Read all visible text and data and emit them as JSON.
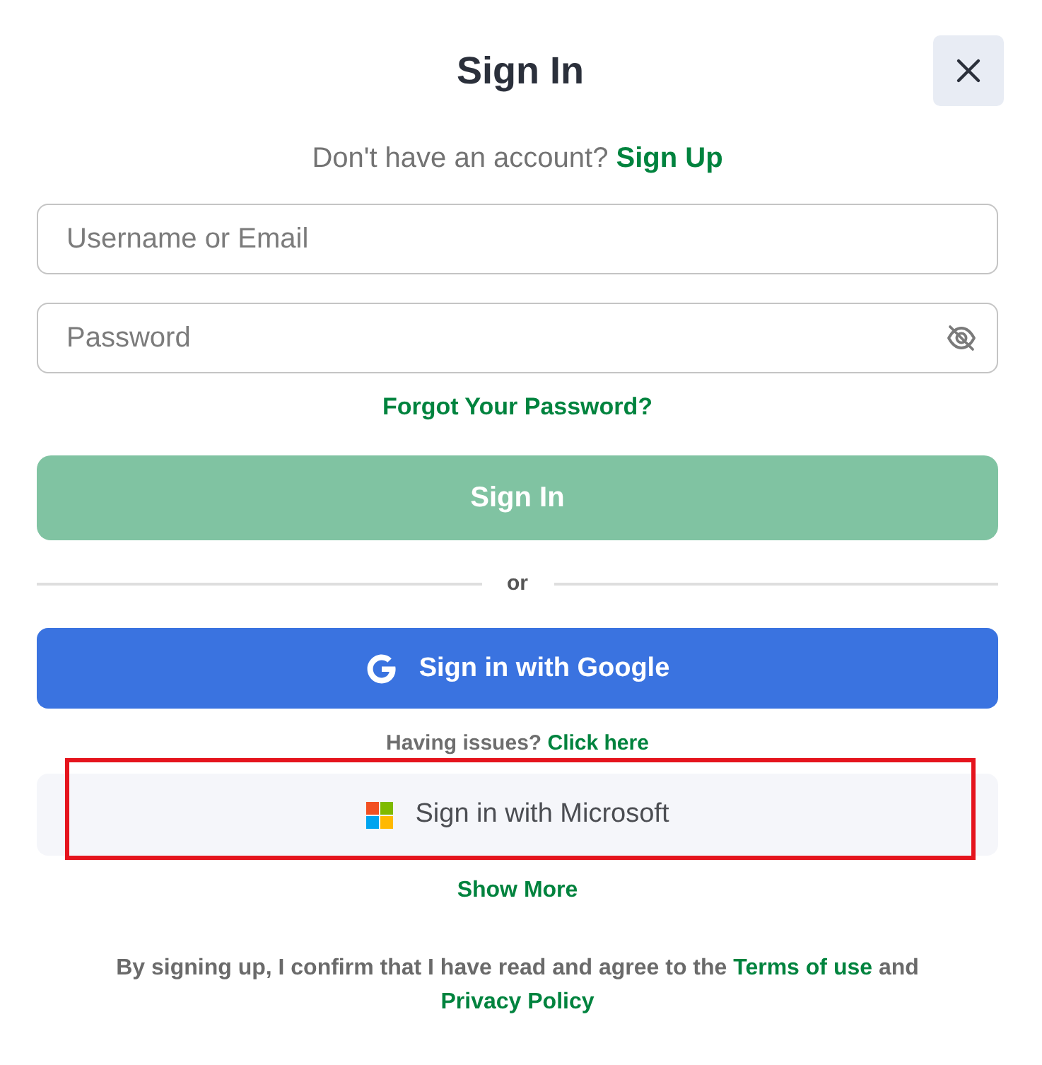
{
  "dialog": {
    "title": "Sign In"
  },
  "signup_prompt": {
    "text": "Don't have an account?",
    "link": "Sign Up"
  },
  "fields": [
    {
      "kind": "text",
      "placeholder": "Username or Email"
    },
    {
      "kind": "password",
      "placeholder": "Password"
    }
  ],
  "forgot_link": "Forgot Your Password?",
  "submit_button": {
    "label": "Sign In",
    "disabled": true
  },
  "divider": "or",
  "google_button": {
    "label": "Sign in with Google"
  },
  "help_prompt": {
    "text": "Having issues?",
    "link": "Click here"
  },
  "microsoft_button": {
    "label": "Sign in with Microsoft",
    "highlighted": true
  },
  "show_more": "Show More",
  "legal": {
    "text": "By signing up, I confirm that I have read and agree to the",
    "terms_link": "Terms of use",
    "joiner": "and",
    "privacy_link": "Privacy Policy"
  }
}
